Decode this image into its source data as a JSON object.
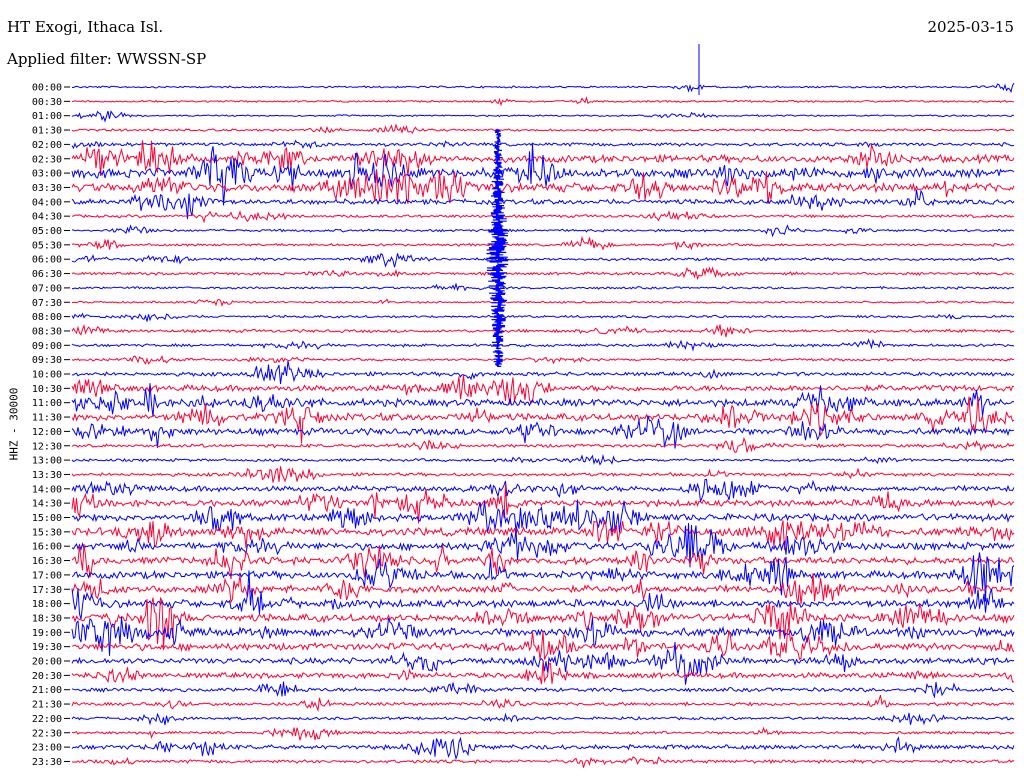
{
  "header": {
    "station": "HT Exogi, Ithaca Isl.",
    "filter": "Applied filter: WWSSN-SP",
    "date": "2025-03-15"
  },
  "chart_data": {
    "type": "helicorder",
    "ylabel": "HHZ - 30000",
    "colors": {
      "even": "#0000ff",
      "odd": "#ff0033"
    },
    "tick_labels": [
      "00:00",
      "00:30",
      "01:00",
      "01:30",
      "02:00",
      "02:30",
      "03:00",
      "03:30",
      "04:00",
      "04:30",
      "05:00",
      "05:30",
      "06:00",
      "06:30",
      "07:00",
      "07:30",
      "08:00",
      "08:30",
      "09:00",
      "09:30",
      "10:00",
      "10:30",
      "11:00",
      "11:30",
      "12:00",
      "12:30",
      "13:00",
      "13:30",
      "14:00",
      "14:30",
      "15:00",
      "15:30",
      "16:00",
      "16:30",
      "17:00",
      "17:30",
      "18:00",
      "18:30",
      "19:00",
      "19:30",
      "20:00",
      "20:30",
      "21:00",
      "21:30",
      "22:00",
      "22:30",
      "23:00",
      "23:30"
    ],
    "activity": [
      0.35,
      0.35,
      0.3,
      0.4,
      0.6,
      1.3,
      1.8,
      1.6,
      0.9,
      0.5,
      0.45,
      0.45,
      0.5,
      0.5,
      0.4,
      0.35,
      0.45,
      0.55,
      0.5,
      0.45,
      0.7,
      1.1,
      1.3,
      1.3,
      1.2,
      0.6,
      0.5,
      0.6,
      1.0,
      1.2,
      1.3,
      1.4,
      1.3,
      1.3,
      1.3,
      1.3,
      1.4,
      1.4,
      1.5,
      1.3,
      1.1,
      1.0,
      0.7,
      0.6,
      0.5,
      0.5,
      0.8,
      0.6
    ]
  }
}
